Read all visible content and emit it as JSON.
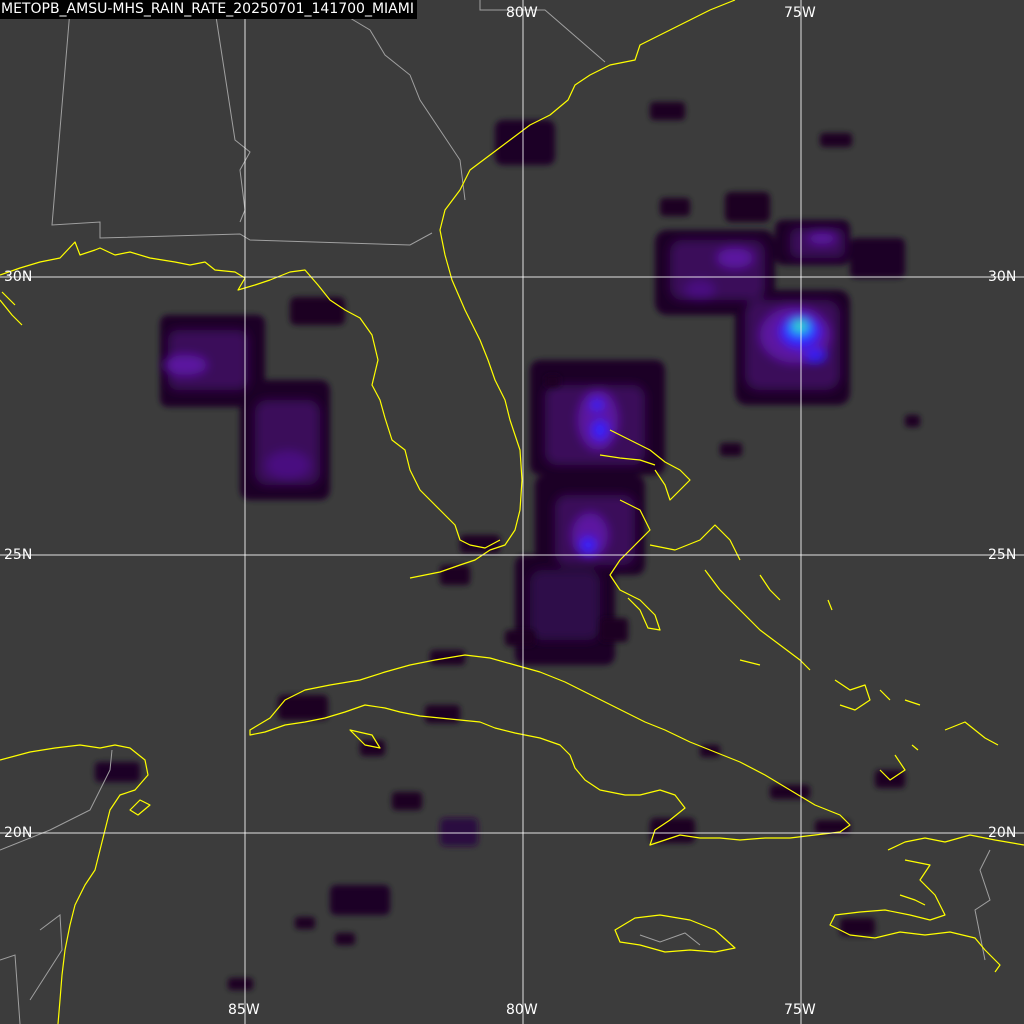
{
  "title": "METOPB_AMSU-MHS_RAIN_RATE_20250701_141700_MIAMI",
  "labels": {
    "lon_top": [
      "80W",
      "75W"
    ],
    "lon_bottom": [
      "85W",
      "80W",
      "75W"
    ],
    "lat_left": [
      "30N",
      "25N",
      "20N"
    ],
    "lat_right": [
      "30N",
      "25N",
      "20N"
    ]
  },
  "colors": {
    "background": "#3c3c3c",
    "coastline": "#ffff00",
    "borders": "#a0a0a0",
    "grid": "#ffffff",
    "rain_scale": [
      "#1a0024",
      "#3a0d5a",
      "#5b12a0",
      "#3020ff",
      "#1a8cff",
      "#40ff80"
    ]
  }
}
